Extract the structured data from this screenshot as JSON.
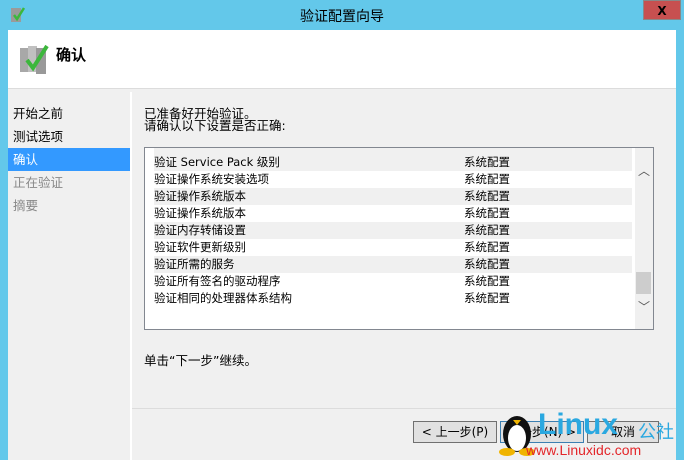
{
  "window": {
    "title": "验证配置向导",
    "close": "X"
  },
  "header": {
    "title": "确认"
  },
  "nav": [
    {
      "label": "开始之前"
    },
    {
      "label": "测试选项"
    },
    {
      "label": "确认"
    },
    {
      "label": "正在验证"
    },
    {
      "label": "摘要"
    }
  ],
  "main": {
    "intro_line1": "已准备好开始验证。",
    "intro_line2": "请确认以下设置是否正确:",
    "rows": [
      {
        "name": "验证 Service Pack 级别",
        "category": "系统配置"
      },
      {
        "name": "验证操作系统安装选项",
        "category": "系统配置"
      },
      {
        "name": "验证操作系统版本",
        "category": "系统配置"
      },
      {
        "name": "验证操作系统版本",
        "category": "系统配置"
      },
      {
        "name": "验证内存转储设置",
        "category": "系统配置"
      },
      {
        "name": "验证软件更新级别",
        "category": "系统配置"
      },
      {
        "name": "验证所需的服务",
        "category": "系统配置"
      },
      {
        "name": "验证所有签名的驱动程序",
        "category": "系统配置"
      },
      {
        "name": "验证相同的处理器体系结构",
        "category": "系统配置"
      }
    ],
    "hint": "单击“下一步”继续。"
  },
  "buttons": {
    "prev": "< 上一步(P)",
    "next": "下一步(N) >",
    "cancel": "取消"
  },
  "watermark": {
    "brand": "Linux",
    "suffix": "公社",
    "url": "www.Linuxidc.com"
  }
}
